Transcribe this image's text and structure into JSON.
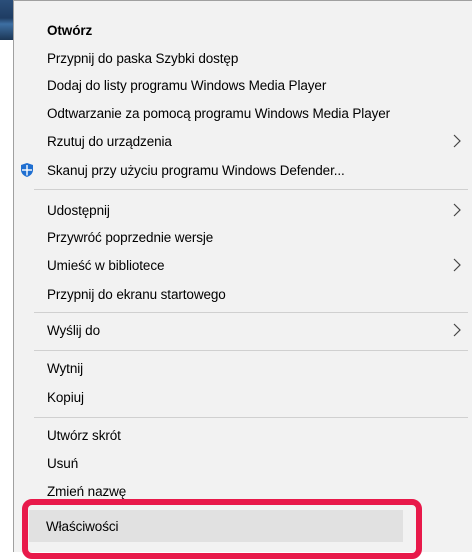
{
  "menu": {
    "items": [
      {
        "label": "Otwórz",
        "bold": true
      },
      {
        "label": "Przypnij do paska Szybki dostęp"
      },
      {
        "label": "Dodaj do listy programu Windows Media Player"
      },
      {
        "label": "Odtwarzanie za pomocą programu Windows Media Player"
      },
      {
        "label": "Rzutuj do urządzenia",
        "submenu": true
      },
      {
        "label": "Skanuj przy użyciu programu Windows Defender...",
        "icon": "windows-defender-shield-icon"
      },
      {
        "label": "Udostępnij",
        "submenu": true
      },
      {
        "label": "Przywróć poprzednie wersje"
      },
      {
        "label": "Umieść w bibliotece",
        "submenu": true
      },
      {
        "label": "Przypnij do ekranu startowego"
      },
      {
        "label": "Wyślij do",
        "submenu": true
      },
      {
        "label": "Wytnij"
      },
      {
        "label": "Kopiuj"
      },
      {
        "label": "Utwórz skrót"
      },
      {
        "label": "Usuń"
      },
      {
        "label": "Zmień nazwę"
      },
      {
        "label": "Właściwości",
        "highlighted": true
      }
    ]
  },
  "colors": {
    "menu_bg": "#f2f2f2",
    "highlight_border": "#e8194a",
    "hover_bg": "#e1e1e1",
    "shield_blue": "#1f6fd1"
  }
}
